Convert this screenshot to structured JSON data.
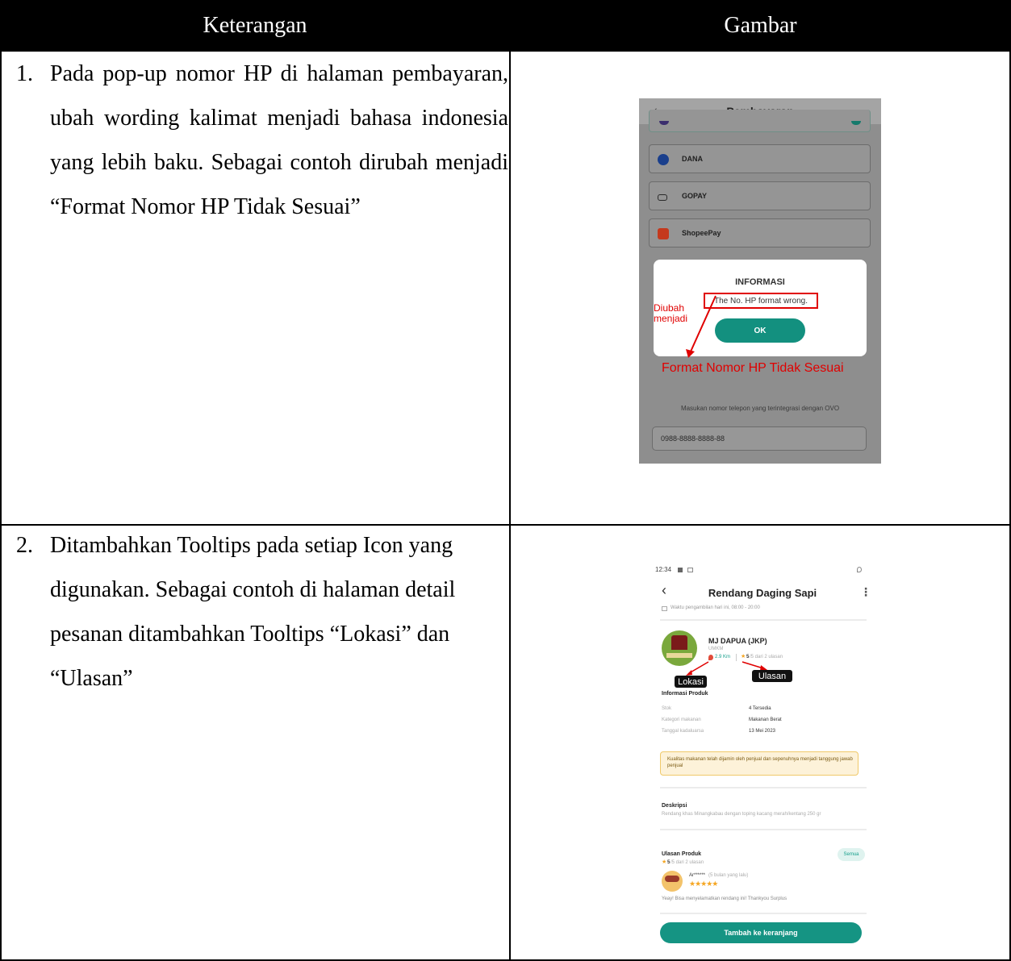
{
  "table": {
    "header_left": "Keterangan",
    "header_right": "Gambar"
  },
  "rows": [
    {
      "number": "1.",
      "text": "Pada pop-up nomor HP di halaman pembayaran, ubah wording kalimat menjadi bahasa indonesia yang lebih baku. Sebagai contoh dirubah menjadi “Format Nomor HP Tidak Sesuai”"
    },
    {
      "number": "2.",
      "text": "Ditambahkan Tooltips pada setiap Icon yang digunakan. Sebagai contoh di halaman detail pesanan ditambahkan Tooltips “Lokasi” dan “Ulasan”"
    }
  ],
  "screen1": {
    "back_glyph": "‹",
    "title": "Pembayaran",
    "options": [
      {
        "label": "DANA",
        "icon": "dana-icon",
        "color": "#1a3f8c"
      },
      {
        "label": "GOPAY",
        "icon": "gopay-icon",
        "color": "#2a2a2a"
      },
      {
        "label": "ShopeePay",
        "icon": "shopeepay-icon",
        "color": "#c4391d"
      }
    ],
    "modal_title": "INFORMASI",
    "modal_message": "The No. HP format wrong.",
    "ok_label": "OK",
    "annotation_arrow_label": "Diubah menjadi",
    "annotation_replacement": "Format Nomor HP Tidak Sesuai",
    "phone_hint": "Masukan nomor telepon yang terintegrasi dengan OVO",
    "phone_value": "0988-8888-8888-88",
    "annotation_color": "#e00000"
  },
  "screen2": {
    "status_time": "12:34",
    "title": "Rendang Daging Sapi",
    "pickup_info": "Waktu pengambilan hari ini, 08:00 - 20:00",
    "store_name": "MJ DAPUA (JKP)",
    "store_type": "UMKM",
    "distance": "2.9 Km",
    "rating": "5",
    "rating_count": "/5 dari 2 ulasan",
    "tooltip_location": "Lokasi",
    "tooltip_reviews": "Ulasan",
    "product_info_title": "Informasi Produk",
    "info_rows": [
      {
        "label": "Stok",
        "value": "4 Tersedia"
      },
      {
        "label": "Kategori makanan",
        "value": "Makanan Berat"
      },
      {
        "label": "Tanggal kadaluarsa",
        "value": "13 Mei 2023"
      }
    ],
    "notice": "Kualitas makanan telah dijamin oleh penjual dan sepenuhnya menjadi tanggung jawab penjual",
    "description_title": "Deskripsi",
    "description": "Rendang khas Minangkabau dengan toping kacang merah/kentang 250 gr",
    "reviews_title": "Ulasan Produk",
    "see_all": "Semua",
    "review_summary": "/5 dari 2 ulasan",
    "reviewer": "Ar******",
    "review_age": "(5 bulan yang lalu)",
    "review_stars": "★★★★★",
    "review_text": "Yeay! Bisa menyelamatkan rendang ini! Thankyou Surplus",
    "add_to_cart": "Tambah ke keranjang",
    "accent_color": "#159483"
  }
}
